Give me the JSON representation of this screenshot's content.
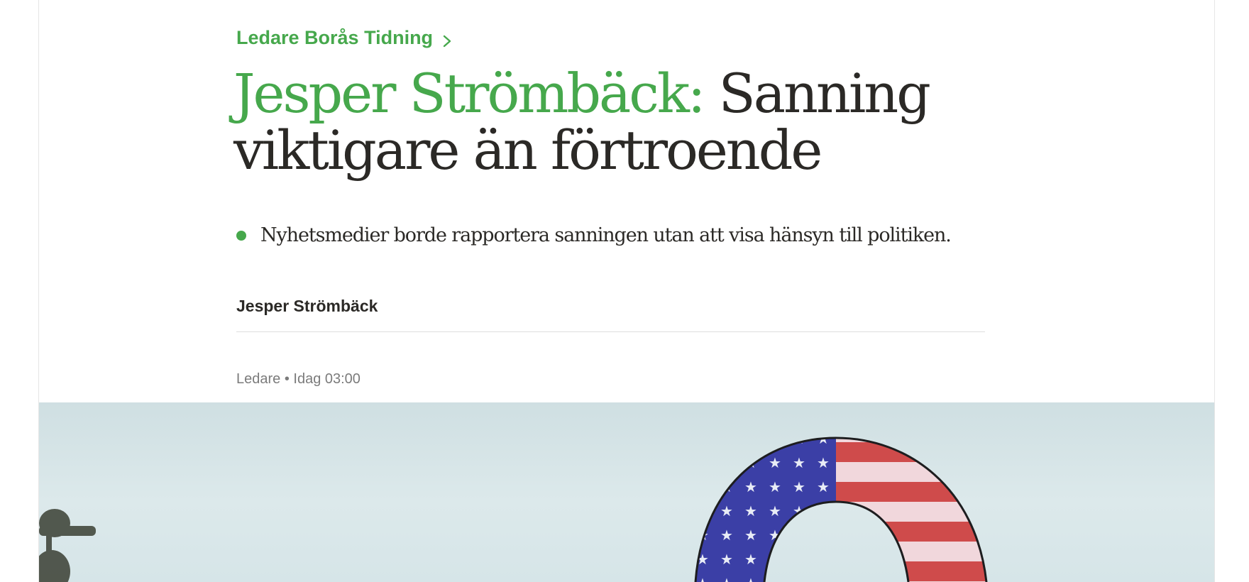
{
  "article": {
    "section_label": "Ledare Borås Tidning",
    "headline_author": "Jesper Strömbäck:",
    "headline_title": " Sanning viktigare än förtroende",
    "lead": "Nyhetsmedier borde rapportera sanningen utan att visa hänsyn till politiken.",
    "byline": "Jesper Strömbäck",
    "meta": "Ledare • Idag 03:00"
  },
  "colors": {
    "accent": "#46a84c",
    "text": "#2b2926",
    "meta": "#7b7b7b"
  },
  "icons": {
    "section_chevron": "chevron-right-icon",
    "lead_bullet": "bullet-dot-icon"
  }
}
